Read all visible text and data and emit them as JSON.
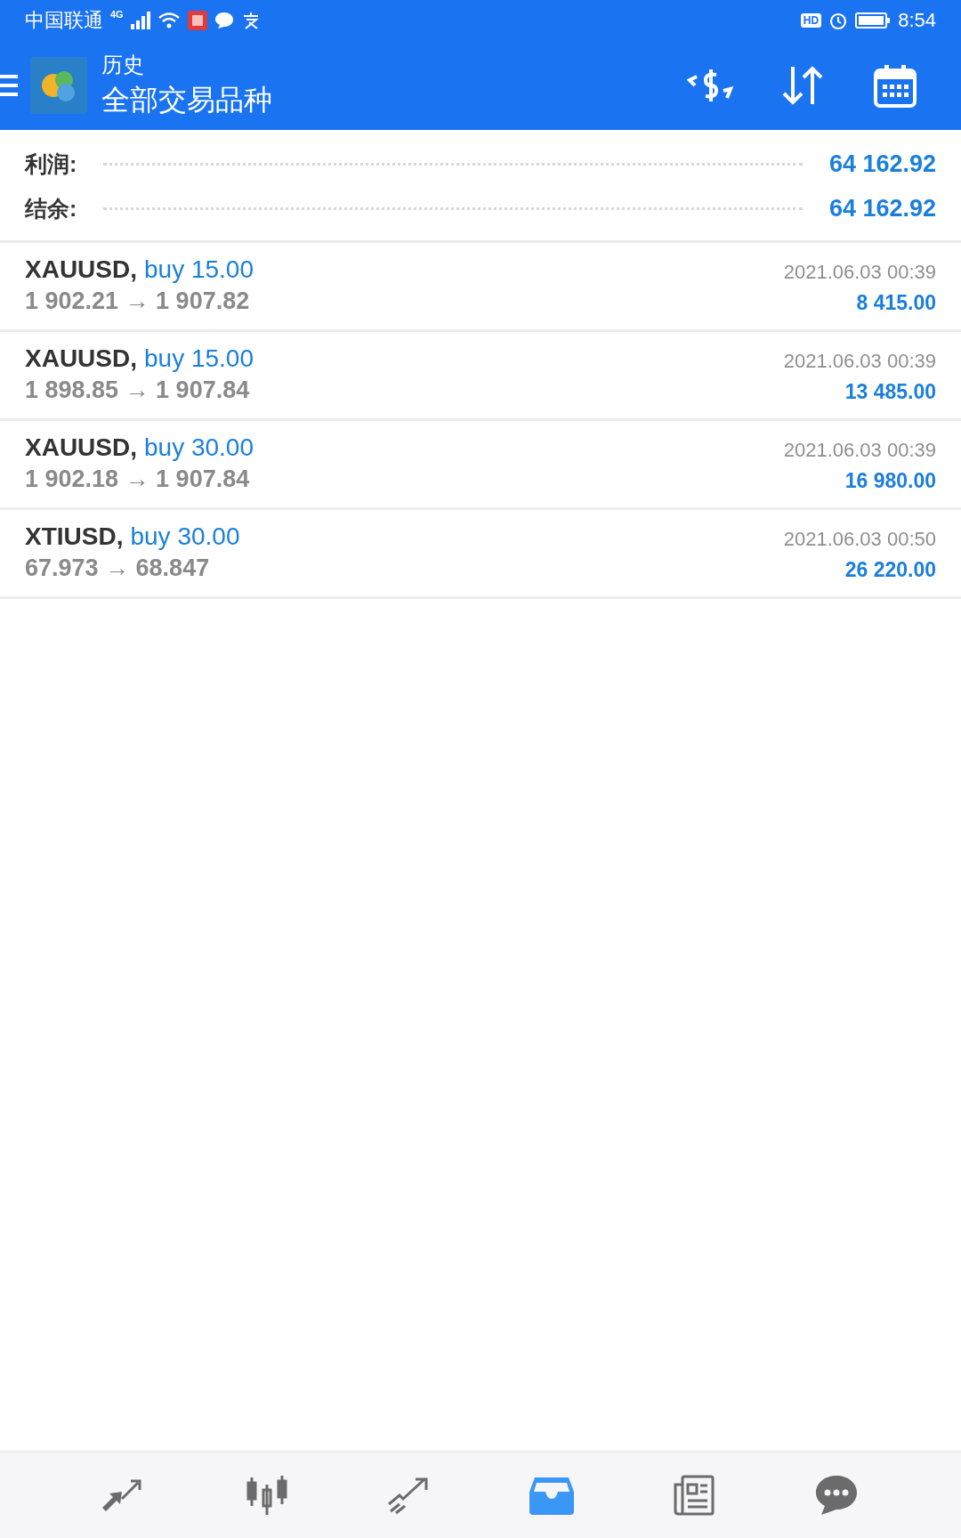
{
  "status_bar": {
    "carrier": "中国联通",
    "network": "4G",
    "hd": "HD",
    "time": "8:54"
  },
  "header": {
    "title": "历史",
    "subtitle": "全部交易品种"
  },
  "summary": [
    {
      "label": "利润:",
      "value": "64 162.92"
    },
    {
      "label": "结余:",
      "value": "64 162.92"
    }
  ],
  "deals": [
    {
      "symbol": "XAUUSD,",
      "side": "buy 15.00",
      "prices": "1 902.21 → 1 907.82",
      "time": "2021.06.03 00:39",
      "profit": "8 415.00"
    },
    {
      "symbol": "XAUUSD,",
      "side": "buy 15.00",
      "prices": "1 898.85 → 1 907.84",
      "time": "2021.06.03 00:39",
      "profit": "13 485.00"
    },
    {
      "symbol": "XAUUSD,",
      "side": "buy 30.00",
      "prices": "1 902.18 → 1 907.84",
      "time": "2021.06.03 00:39",
      "profit": "16 980.00"
    },
    {
      "symbol": "XTIUSD,",
      "side": "buy 30.00",
      "prices": "67.973 → 68.847",
      "time": "2021.06.03 00:50",
      "profit": "26 220.00"
    }
  ],
  "nav": [
    {
      "kind": "quotes",
      "selected": false
    },
    {
      "kind": "chart",
      "selected": false
    },
    {
      "kind": "trade",
      "selected": false
    },
    {
      "kind": "history",
      "selected": true
    },
    {
      "kind": "news",
      "selected": false
    },
    {
      "kind": "chat",
      "selected": false
    }
  ]
}
